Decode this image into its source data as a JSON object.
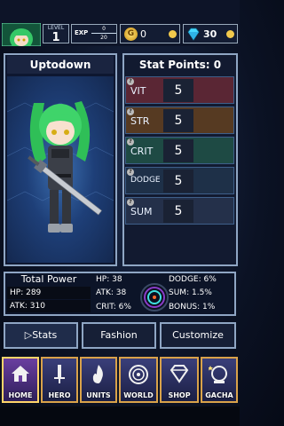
{
  "topbar": {
    "level_label": "LEVEL",
    "level": "1",
    "exp_label": "EXP",
    "exp_current": "0",
    "exp_max": "20",
    "coin_glyph": "G",
    "gold": "0",
    "gems": "30"
  },
  "character": {
    "name": "Uptodown"
  },
  "stats": {
    "title": "Stat Points: 0",
    "rows": [
      {
        "label": "VIT",
        "value": "5"
      },
      {
        "label": "STR",
        "value": "5"
      },
      {
        "label": "CRIT",
        "value": "5"
      },
      {
        "label": "DODGE",
        "value": "5"
      },
      {
        "label": "SUM",
        "value": "5"
      }
    ]
  },
  "summary": {
    "total_power_label": "Total Power",
    "hp_label": "HP:",
    "hp": "289",
    "atk_label": "ATK:",
    "atk": "310",
    "mid": [
      {
        "label": "HP:",
        "value": "38"
      },
      {
        "label": "ATK:",
        "value": "38"
      },
      {
        "label": "CRIT:",
        "value": "6%"
      }
    ],
    "right": [
      {
        "label": "DODGE:",
        "value": "6%"
      },
      {
        "label": "SUM:",
        "value": "1.5%"
      },
      {
        "label": "BONUS:",
        "value": "1%"
      }
    ]
  },
  "tabs": [
    "Stats",
    "Fashion",
    "Customize"
  ],
  "nav": [
    "HOME",
    "HERO",
    "UNITS",
    "WORLD",
    "SHOP",
    "GACHA"
  ],
  "colors": {
    "accent": "#8fa6c4",
    "nav_border": "#d9a24a",
    "hair": "#3fd46a"
  }
}
